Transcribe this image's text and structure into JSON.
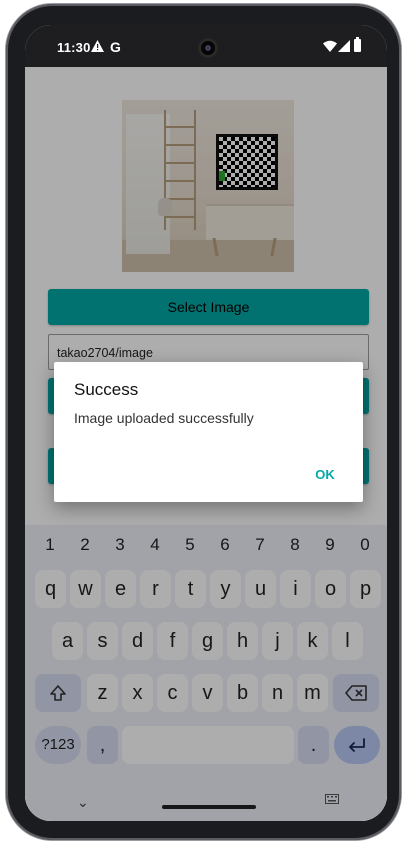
{
  "status_bar": {
    "time": "11:30",
    "icons": [
      "warning-icon",
      "google-icon",
      "wifi-icon",
      "cell-signal-icon",
      "battery-icon"
    ]
  },
  "app": {
    "select_image_label": "Select Image",
    "repo_input_value": "takao2704/image",
    "accent_color": "#03a9a7"
  },
  "dialog": {
    "title": "Success",
    "message": "Image uploaded successfully",
    "ok_label": "OK"
  },
  "keyboard": {
    "numbers": [
      "1",
      "2",
      "3",
      "4",
      "5",
      "6",
      "7",
      "8",
      "9",
      "0"
    ],
    "row1": [
      "q",
      "w",
      "e",
      "r",
      "t",
      "y",
      "u",
      "i",
      "o",
      "p"
    ],
    "row2": [
      "a",
      "s",
      "d",
      "f",
      "g",
      "h",
      "j",
      "k",
      "l"
    ],
    "row3": [
      "z",
      "x",
      "c",
      "v",
      "b",
      "n",
      "m"
    ],
    "symbols_label": "?123",
    "comma_label": ",",
    "period_label": "."
  }
}
